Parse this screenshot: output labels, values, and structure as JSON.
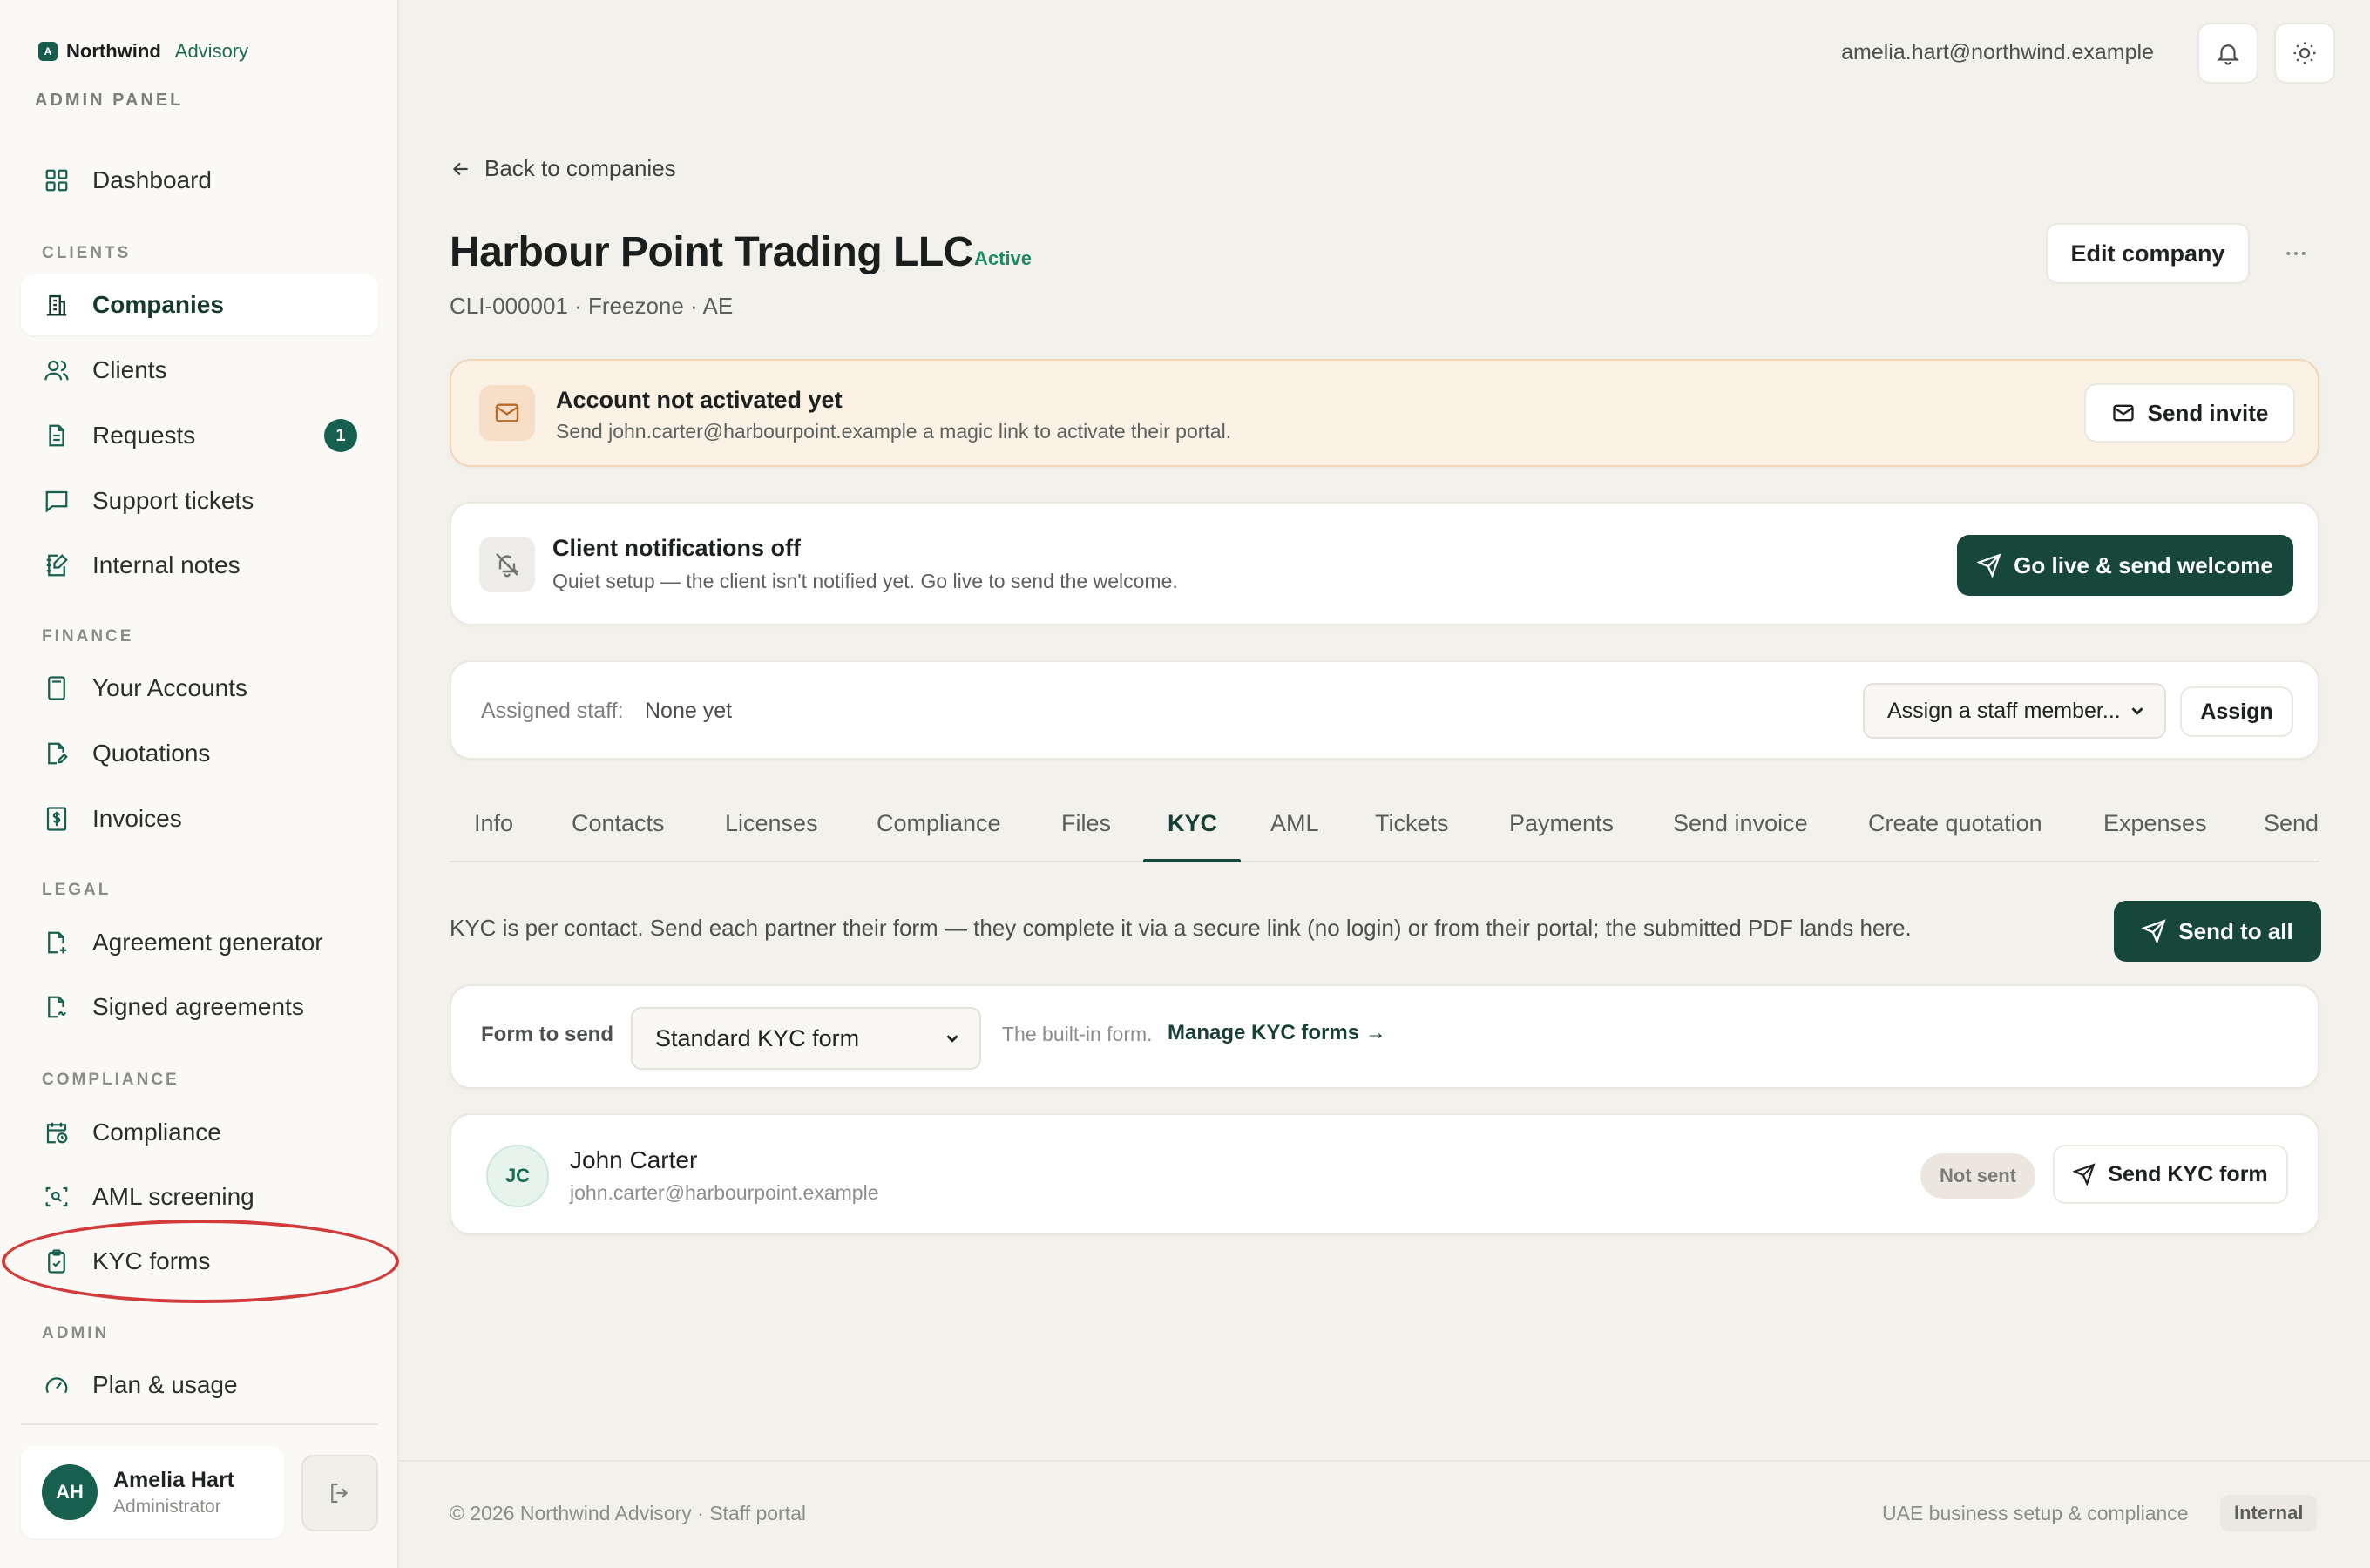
{
  "brand": {
    "mark": "A",
    "name": "Northwind",
    "sub": "Advisory",
    "panel": "ADMIN PANEL"
  },
  "sidebar": {
    "dashboard": "Dashboard",
    "sections": {
      "clients": "CLIENTS",
      "finance": "FINANCE",
      "legal": "LEGAL",
      "compliance": "COMPLIANCE",
      "admin": "ADMIN"
    },
    "items": {
      "companies": "Companies",
      "clients": "Clients",
      "requests": "Requests",
      "requests_badge": "1",
      "support_tickets": "Support tickets",
      "internal_notes": "Internal notes",
      "your_accounts": "Your Accounts",
      "quotations": "Quotations",
      "invoices": "Invoices",
      "agreement_generator": "Agreement generator",
      "signed_agreements": "Signed agreements",
      "compliance": "Compliance",
      "aml_screening": "AML screening",
      "kyc_forms": "KYC forms",
      "plan_usage": "Plan & usage"
    },
    "user": {
      "initials": "AH",
      "name": "Amelia Hart",
      "role": "Administrator"
    }
  },
  "topbar": {
    "email": "amelia.hart@northwind.example"
  },
  "main": {
    "back": "Back to companies",
    "title": "Harbour Point Trading LLC",
    "status": "Active",
    "meta": "CLI-000001 · Freezone · AE",
    "edit_button": "Edit company",
    "activation": {
      "title": "Account not activated yet",
      "subtitle": "Send john.carter@harbourpoint.example a magic link to activate their portal.",
      "button": "Send invite"
    },
    "notifications": {
      "title": "Client notifications off",
      "subtitle": "Quiet setup — the client isn't notified yet. Go live to send the welcome.",
      "button": "Go live & send welcome"
    },
    "staff": {
      "label": "Assigned staff:",
      "value": "None yet",
      "select_placeholder": "Assign a staff member...",
      "assign_button": "Assign"
    },
    "tabs": [
      "Info",
      "Contacts",
      "Licenses",
      "Compliance",
      "Files",
      "KYC",
      "AML",
      "Tickets",
      "Payments",
      "Send invoice",
      "Create quotation",
      "Expenses",
      "Send"
    ],
    "active_tab": "KYC",
    "kyc": {
      "description": "KYC is per contact. Send each partner their form — they complete it via a secure link (no login) or from their portal; the submitted PDF lands here.",
      "send_all": "Send to all",
      "form_label": "Form to send",
      "form_selected": "Standard KYC form",
      "builtin_note": "The built-in form.",
      "manage_link": "Manage KYC forms →",
      "contacts": [
        {
          "initials": "JC",
          "name": "John Carter",
          "email": "john.carter@harbourpoint.example",
          "status": "Not sent",
          "action": "Send KYC form"
        }
      ]
    }
  },
  "footer": {
    "left": "© 2026 Northwind Advisory · Staff portal",
    "right": "UAE business setup & compliance",
    "badge": "Internal"
  },
  "colors": {
    "accent": "#17473b",
    "brand": "#175c4c",
    "warning_bg": "#fbf1e4",
    "highlight": "#d13b3b"
  }
}
